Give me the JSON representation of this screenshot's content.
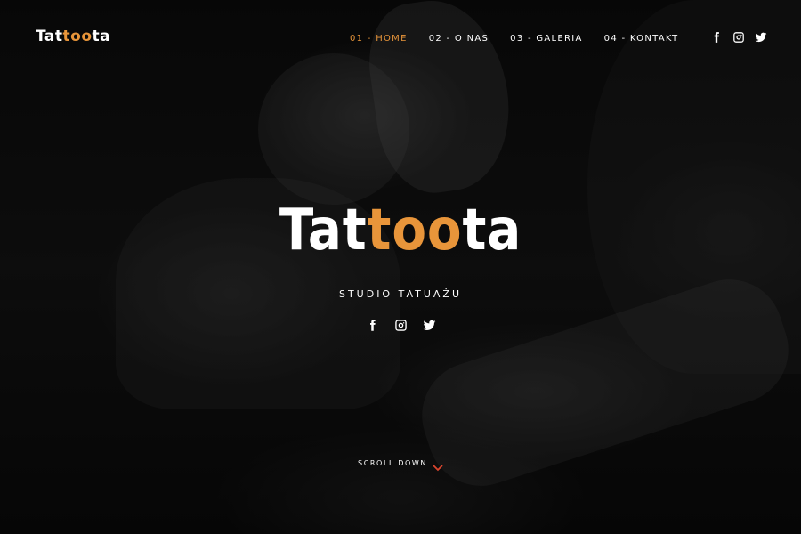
{
  "brand": {
    "logo_part1": "Tat",
    "logo_accent": "too",
    "logo_part2": "ta",
    "accent_color": "#e8953a"
  },
  "nav": {
    "items": [
      {
        "label": "01 - HOME",
        "active": true
      },
      {
        "label": "02 - O NAS",
        "active": false
      },
      {
        "label": "03 - GALERIA",
        "active": false
      },
      {
        "label": "04 - KONTAKT",
        "active": false
      }
    ]
  },
  "social": {
    "icons": [
      "facebook-icon",
      "instagram-icon",
      "twitter-icon"
    ]
  },
  "hero": {
    "title_part1": "Tat",
    "title_accent": "too",
    "title_part2": "ta",
    "subtitle": "STUDIO TATUAŻU",
    "scroll_label": "SCROLL DOWN",
    "scroll_chevron_color": "#d9452e"
  }
}
